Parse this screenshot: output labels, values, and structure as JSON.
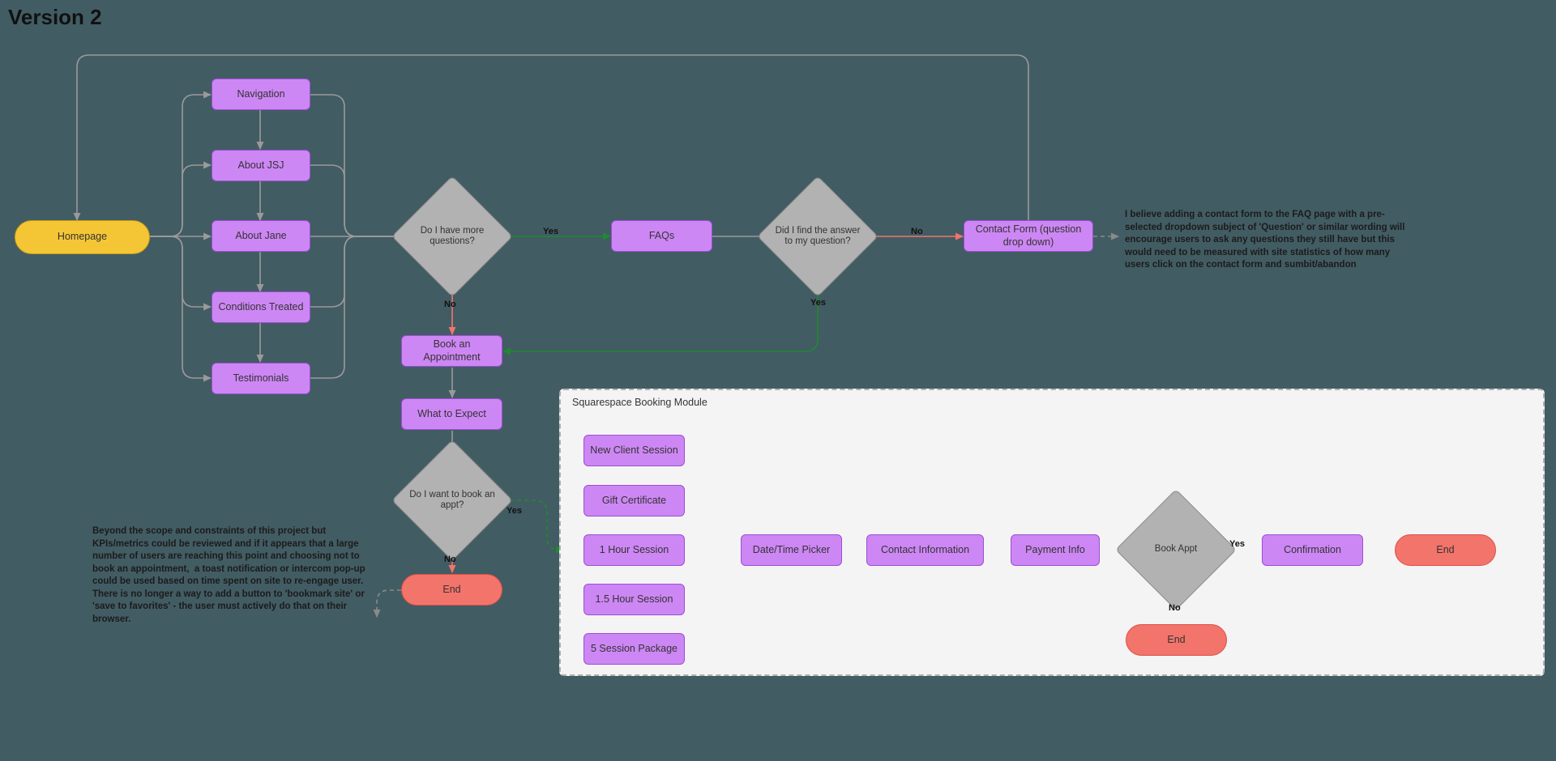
{
  "title": "Version 2",
  "homepage": "Homepage",
  "info_pages": {
    "nav": "Navigation",
    "about_jsj": "About JSJ",
    "about_jane": "About Jane",
    "conditions": "Conditions Treated",
    "testimonials": "Testimonials"
  },
  "decisions": {
    "more_q": "Do I have more questions?",
    "found_ans": "Did I find the answer to my question?",
    "want_book": "Do I want to book an appt?",
    "book_appt": "Book Appt"
  },
  "steps": {
    "faqs": "FAQs",
    "contact_form": "Contact Form (question drop down)",
    "book_apt": "Book an Appointment",
    "what_expect": "What to Expect",
    "end1": "End",
    "end2": "End",
    "end3": "End"
  },
  "module": {
    "title": "Squarespace Booking Module",
    "options": {
      "new_client": "New Client Session",
      "gift": "Gift Certificate",
      "one_hr": "1 Hour Session",
      "one5_hr": "1.5 Hour Session",
      "five_pkg": "5 Session Package"
    },
    "flow": {
      "date": "Date/Time Picker",
      "contact": "Contact Information",
      "payment": "Payment Info",
      "confirm": "Confirmation"
    }
  },
  "labels": {
    "yes1": "Yes",
    "no1": "No",
    "yes2": "Yes",
    "no2": "No",
    "yes3": "Yes",
    "no3": "No",
    "yes4": "Yes",
    "no4": "No"
  },
  "notes": {
    "contact": "I believe adding a contact form to the FAQ page with a pre-selected dropdown subject of 'Question' or similar wording will encourage users to ask any questions they still have but this would need to be measured with site statistics of how many users click on the contact form and sumbit/abandon",
    "end": "Beyond the scope and constraints of this project but KPIs/metrics could be reviewed and if it appears that a large number of users are reaching this point and choosing not to book an appointment,  a toast notification or intercom pop-up could be used based on time spent on site to re-engage user.\nThere is no longer a way to add a button to 'bookmark site' or 'save to favorites' - the user must actively do that on their browser."
  }
}
